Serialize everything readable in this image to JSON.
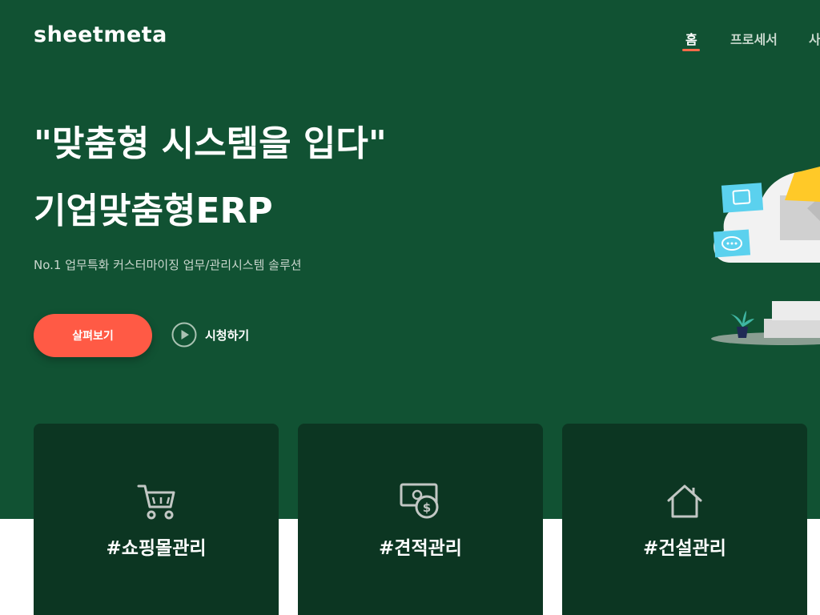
{
  "brand": {
    "logo": "sheetmeta"
  },
  "nav": {
    "items": [
      {
        "label": "홈",
        "active": true
      },
      {
        "label": "프로세서",
        "active": false
      },
      {
        "label": "사",
        "active": false
      }
    ]
  },
  "hero": {
    "headline_line1": "\"맞춤형 시스템을 입다\"",
    "headline_line2": "기업맞춤형ERP",
    "subtitle": "No.1 업무특화 커스터마이징 업무/관리시스템 솔루션",
    "cta_label": "살펴보기",
    "watch_label": "시청하기"
  },
  "cards": [
    {
      "label": "#쇼핑몰관리",
      "icon": "shopping-cart-icon"
    },
    {
      "label": "#견적관리",
      "icon": "money-icon"
    },
    {
      "label": "#건설관리",
      "icon": "house-icon"
    }
  ],
  "colors": {
    "hero_bg": "#115233",
    "card_bg": "#0c3622",
    "accent": "#ff5a45"
  }
}
